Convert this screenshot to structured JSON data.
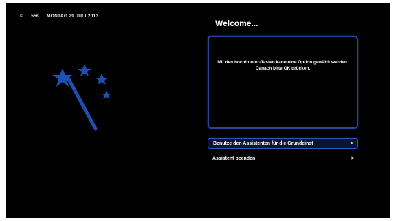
{
  "statusbar": {
    "icon": "©",
    "channel": "556",
    "date": "MONTAG 29 JULI 2013"
  },
  "wizard": {
    "title": "Welcome...",
    "info_text": "Mit den hoch/runter-Tasten kann eine Option gewählt werden. Danach bitte OK drücken."
  },
  "menu": {
    "items": [
      {
        "label": "Benutze den Assistenten für die Grundeinst",
        "arrow": ">",
        "selected": true
      },
      {
        "label": "Assistent beenden",
        "arrow": ">",
        "selected": false
      }
    ]
  },
  "colors": {
    "background": "#000000",
    "accent": "#2f56c4",
    "wand": "#1f4fb0"
  },
  "icons": {
    "wizard_graphic": "magic-wand-icon"
  }
}
